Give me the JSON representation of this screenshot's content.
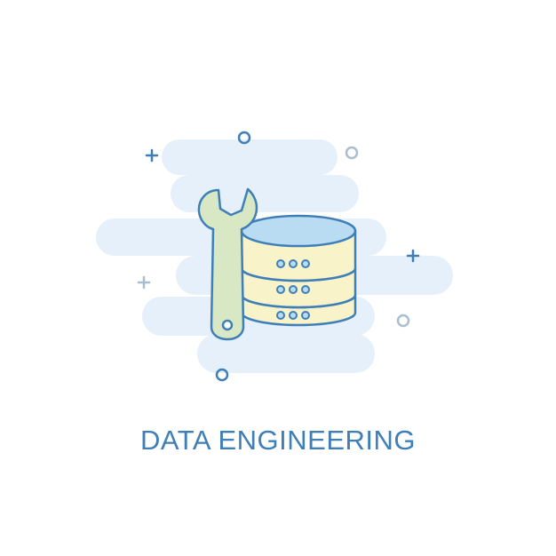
{
  "caption": "DATA ENGINEERING",
  "icons": {
    "main": "database-icon",
    "tool": "wrench-icon"
  },
  "colors": {
    "outline": "#3f7fb8",
    "cloud": "#e6f0fa",
    "database_top": "#b9dcf2",
    "database_body": "#f9f3c9",
    "wrench": "#d8e7c4",
    "decor": "#a9bfcf"
  }
}
